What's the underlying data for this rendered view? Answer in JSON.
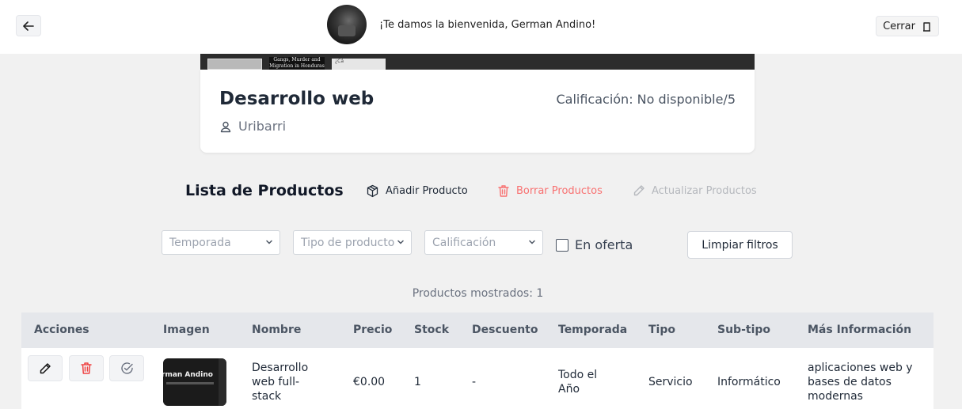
{
  "header": {
    "welcome": "¡Te damos la bienvenida, German Andino!",
    "logout_label": "Cerrar"
  },
  "banner": {
    "thumb_title": "Gangs, Murder and Migration in Honduras",
    "thumb_small": "¿Cá"
  },
  "store": {
    "title": "Desarrollo web",
    "owner": "Uribarri",
    "rating": "Calificación: No disponible/5"
  },
  "products": {
    "list_title": "Lista de Productos",
    "add_label": "Añadir Producto",
    "delete_label": "Borrar Productos",
    "update_label": "Actualizar Productos"
  },
  "filters": {
    "season": "Temporada",
    "product_type": "Tipo de producto",
    "rating": "Calificación",
    "on_sale": "En oferta",
    "clear": "Limpiar filtros"
  },
  "count_text": "Productos mostrados: 1",
  "table": {
    "headers": [
      "Acciones",
      "Imagen",
      "Nombre",
      "Precio",
      "Stock",
      "Descuento",
      "Temporada",
      "Tipo",
      "Sub-tipo",
      "Más Información"
    ],
    "rows": [
      {
        "image_text": "rman Andino",
        "name": "Desarrollo web full-stack",
        "price": "€0.00",
        "stock": "1",
        "discount": "-",
        "season": "Todo el Año",
        "type": "Servicio",
        "subtype": "Informático",
        "info": "aplicaciones web y bases de datos modernas"
      }
    ]
  },
  "colors": {
    "delete": "#f87171",
    "disabled": "#b5b8bd",
    "table_header": "#e5e7eb"
  }
}
